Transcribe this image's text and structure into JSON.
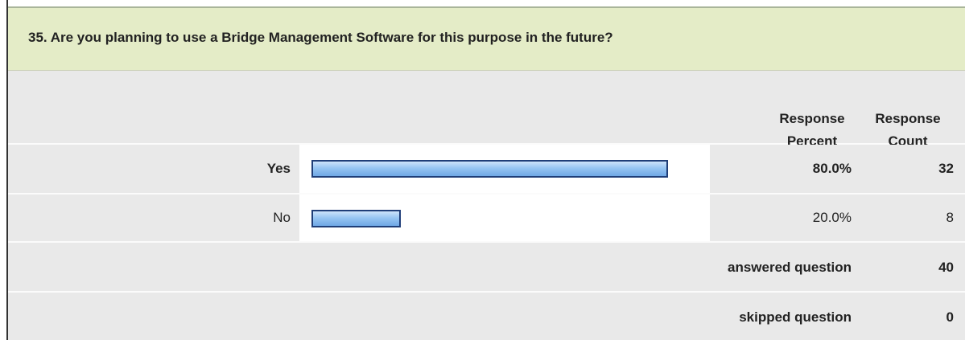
{
  "question": {
    "title": "35. Are you planning to use a Bridge Management Software for this purpose in the future?"
  },
  "table": {
    "header_percent_line1": "Response",
    "header_percent_line2": "Percent",
    "header_count_line1": "Response",
    "header_count_line2": "Count"
  },
  "chart_data": {
    "type": "bar",
    "categories": [
      "Yes",
      "No"
    ],
    "values": [
      80.0,
      20.0
    ],
    "percent_labels": [
      "80.0%",
      "20.0%"
    ],
    "counts": [
      "32",
      "8"
    ],
    "xlim": [
      0,
      100
    ],
    "bar_color": "#97c5f2",
    "bar_border_color": "#1f3e78"
  },
  "summary": {
    "answered_label": "answered question",
    "answered_value": "40",
    "skipped_label": "skipped question",
    "skipped_value": "0"
  },
  "colors": {
    "title_background": "#e4ecc7",
    "row_background": "#e9e9e9"
  }
}
